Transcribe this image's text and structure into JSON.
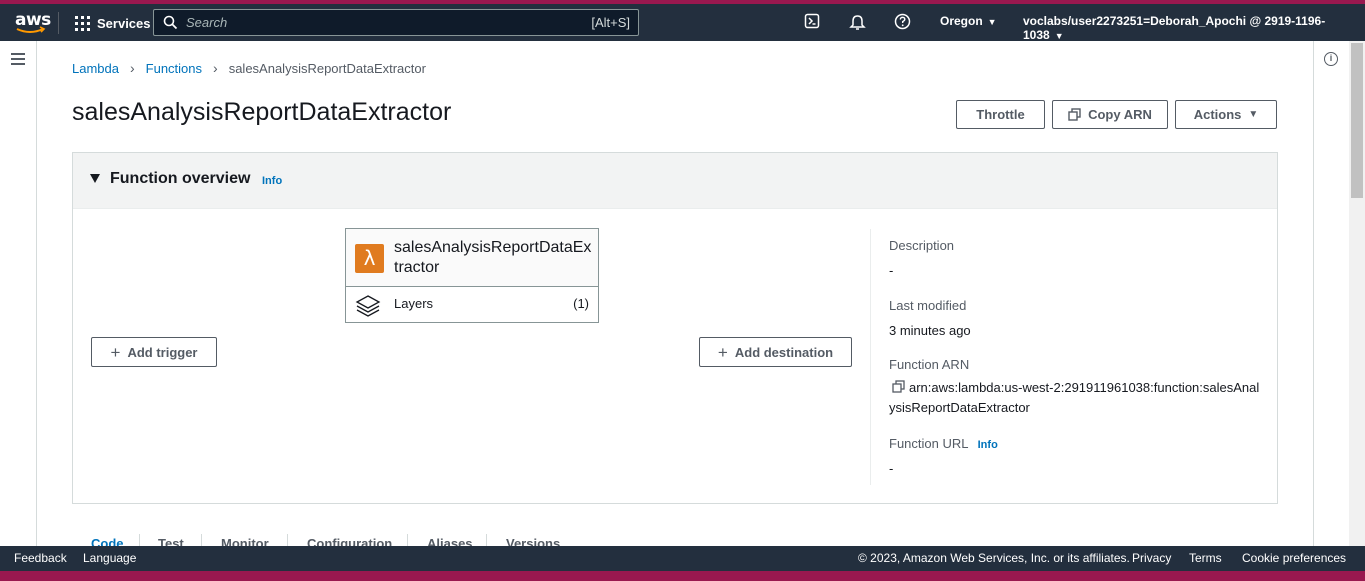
{
  "nav": {
    "logo": "aws",
    "services_label": "Services",
    "search_placeholder": "Search",
    "search_shortcut": "[Alt+S]",
    "region": "Oregon",
    "user": "voclabs/user2273251=Deborah_Apochi @ 2919-1196-1038"
  },
  "breadcrumb": {
    "lambda": "Lambda",
    "functions": "Functions",
    "current": "salesAnalysisReportDataExtractor"
  },
  "page": {
    "title": "salesAnalysisReportDataExtractor"
  },
  "header_buttons": {
    "throttle": "Throttle",
    "copy_arn": "Copy ARN",
    "actions": "Actions"
  },
  "overview": {
    "title": "Function overview",
    "info": "Info",
    "function_name": "salesAnalysisReportDataExtractor",
    "layers_label": "Layers",
    "layers_count": "(1)",
    "add_trigger": "Add trigger",
    "add_destination": "Add destination"
  },
  "details": {
    "description_label": "Description",
    "description_value": "-",
    "last_modified_label": "Last modified",
    "last_modified_value": "3 minutes ago",
    "arn_label": "Function ARN",
    "arn_value": "arn:aws:lambda:us-west-2:291911961038:function:salesAnalysisReportDataExtractor",
    "url_label": "Function URL",
    "url_info": "Info",
    "url_value": "-"
  },
  "tabs": [
    "Code",
    "Test",
    "Monitor",
    "Configuration",
    "Aliases",
    "Versions"
  ],
  "footer": {
    "feedback": "Feedback",
    "language": "Language",
    "copyright": "© 2023, Amazon Web Services, Inc. or its affiliates.",
    "privacy": "Privacy",
    "terms": "Terms",
    "cookies": "Cookie preferences"
  },
  "colors": {
    "nav_bg": "#232f3e",
    "accent_stripe": "#99184f",
    "link": "#0073bb",
    "lambda_orange": "#e07b1f"
  }
}
